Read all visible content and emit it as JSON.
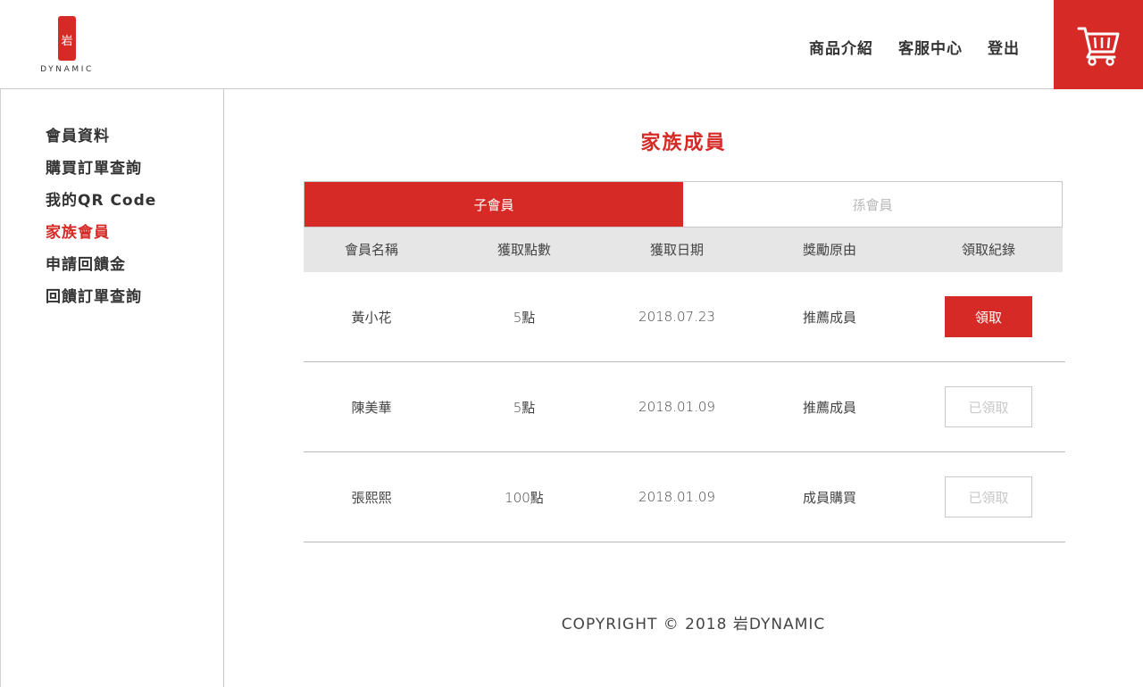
{
  "header": {
    "logo_glyph": "岩",
    "logo_text": "DYNAMIC",
    "nav": [
      {
        "label": "商品介紹"
      },
      {
        "label": "客服中心"
      },
      {
        "label": "登出"
      }
    ],
    "cart_icon": "shopping-cart-icon"
  },
  "sidebar": {
    "items": [
      {
        "label": "會員資料"
      },
      {
        "label": "購買訂單查詢"
      },
      {
        "label": "我的QR Code"
      },
      {
        "label": "家族會員"
      },
      {
        "label": "申請回饋金"
      },
      {
        "label": "回饋訂單查詢"
      }
    ],
    "active_index": 3
  },
  "main": {
    "title": "家族成員",
    "tabs": [
      {
        "label": "子會員"
      },
      {
        "label": "孫會員"
      }
    ],
    "active_tab": 0,
    "table": {
      "headers": [
        "會員名稱",
        "獲取點數",
        "獲取日期",
        "獎勵原由",
        "領取紀錄"
      ],
      "rows": [
        {
          "name": "黃小花",
          "points": "5點",
          "date": "2018.07.23",
          "reason": "推薦成員",
          "action": "領取",
          "claimed": false
        },
        {
          "name": "陳美華",
          "points": "5點",
          "date": "2018.01.09",
          "reason": "推薦成員",
          "action": "已領取",
          "claimed": true
        },
        {
          "name": "張熙熙",
          "points": "100點",
          "date": "2018.01.09",
          "reason": "成員購買",
          "action": "已領取",
          "claimed": true
        }
      ]
    }
  },
  "footer": {
    "copyright": "COPYRIGHT © 2018 岩DYNAMIC"
  },
  "colors": {
    "accent": "#d52a26",
    "header_row_bg": "#e6e6e6",
    "disabled": "#c8c8c8"
  }
}
